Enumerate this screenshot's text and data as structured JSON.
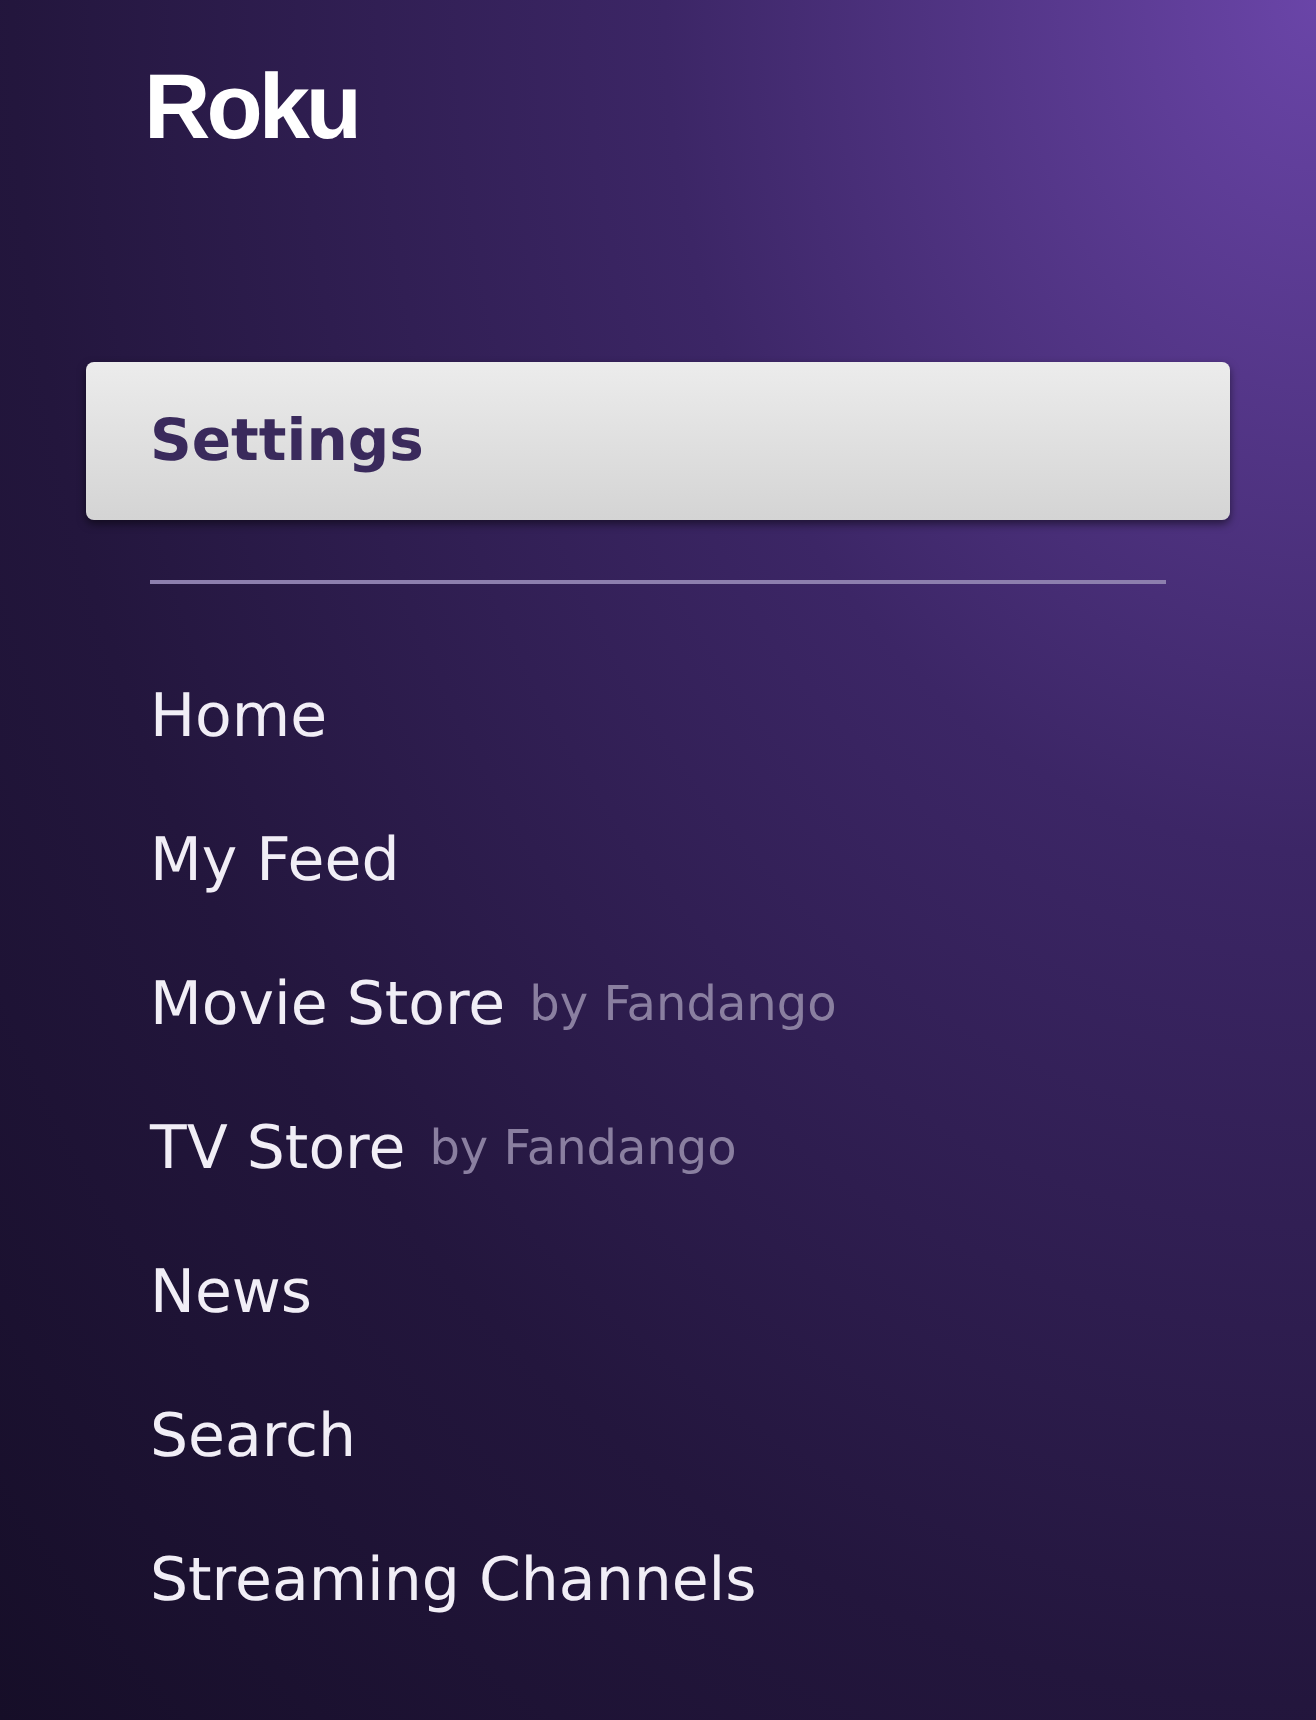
{
  "logo": "Roku",
  "top_items": [
    {
      "label": "Settings",
      "selected": true
    }
  ],
  "items": [
    {
      "label": "Home",
      "selected": false
    },
    {
      "label": "My Feed",
      "selected": false
    },
    {
      "label": "Movie Store",
      "suffix": "by Fandango",
      "selected": false
    },
    {
      "label": "TV Store",
      "suffix": "by Fandango",
      "selected": false
    },
    {
      "label": "News",
      "selected": false
    },
    {
      "label": "Search",
      "selected": false
    },
    {
      "label": "Streaming Channels",
      "selected": false
    }
  ]
}
